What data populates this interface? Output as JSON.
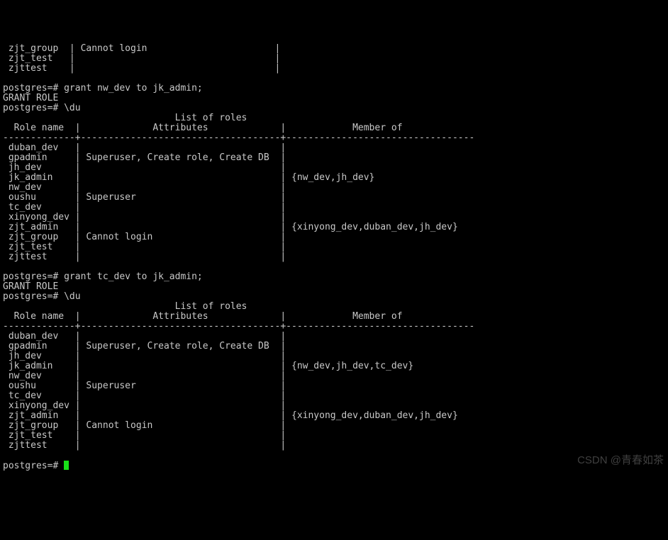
{
  "top": {
    "rows": [
      {
        "role": " zjt_group  ",
        "attrs": " Cannot login                       ",
        "member": ""
      },
      {
        "role": " zjt_test   ",
        "attrs": "                                    ",
        "member": ""
      },
      {
        "role": " zjttest    ",
        "attrs": "                                    ",
        "member": ""
      }
    ]
  },
  "block1": {
    "cmd1_prompt": "postgres=# ",
    "cmd1": "grant nw_dev to jk_admin;",
    "resp1": "GRANT ROLE",
    "cmd2_prompt": "postgres=# ",
    "cmd2": "\\du",
    "title_pad": "                               ",
    "title": "List of roles",
    "header": {
      "role": "  Role name  ",
      "attrs": "             Attributes             ",
      "member": "            Member of             "
    },
    "sep": "-------------+------------------------------------+----------------------------------",
    "rows": [
      {
        "role": " duban_dev   ",
        "attrs": "                                    ",
        "member": ""
      },
      {
        "role": " gpadmin     ",
        "attrs": " Superuser, Create role, Create DB  ",
        "member": ""
      },
      {
        "role": " jh_dev      ",
        "attrs": "                                    ",
        "member": ""
      },
      {
        "role": " jk_admin    ",
        "attrs": "                                    ",
        "member": " {nw_dev,jh_dev}"
      },
      {
        "role": " nw_dev      ",
        "attrs": "                                    ",
        "member": ""
      },
      {
        "role": " oushu       ",
        "attrs": " Superuser                          ",
        "member": ""
      },
      {
        "role": " tc_dev      ",
        "attrs": "                                    ",
        "member": ""
      },
      {
        "role": " xinyong_dev ",
        "attrs": "                                    ",
        "member": ""
      },
      {
        "role": " zjt_admin   ",
        "attrs": "                                    ",
        "member": " {xinyong_dev,duban_dev,jh_dev}"
      },
      {
        "role": " zjt_group   ",
        "attrs": " Cannot login                       ",
        "member": ""
      },
      {
        "role": " zjt_test    ",
        "attrs": "                                    ",
        "member": ""
      },
      {
        "role": " zjttest     ",
        "attrs": "                                    ",
        "member": ""
      }
    ]
  },
  "block2": {
    "cmd1_prompt": "postgres=# ",
    "cmd1": "grant tc_dev to jk_admin;",
    "resp1": "GRANT ROLE",
    "cmd2_prompt": "postgres=# ",
    "cmd2": "\\du",
    "title_pad": "                               ",
    "title": "List of roles",
    "header": {
      "role": "  Role name  ",
      "attrs": "             Attributes             ",
      "member": "            Member of             "
    },
    "sep": "-------------+------------------------------------+----------------------------------",
    "rows": [
      {
        "role": " duban_dev   ",
        "attrs": "                                    ",
        "member": ""
      },
      {
        "role": " gpadmin     ",
        "attrs": " Superuser, Create role, Create DB  ",
        "member": ""
      },
      {
        "role": " jh_dev      ",
        "attrs": "                                    ",
        "member": ""
      },
      {
        "role": " jk_admin    ",
        "attrs": "                                    ",
        "member": " {nw_dev,jh_dev,tc_dev}"
      },
      {
        "role": " nw_dev      ",
        "attrs": "                                    ",
        "member": ""
      },
      {
        "role": " oushu       ",
        "attrs": " Superuser                          ",
        "member": ""
      },
      {
        "role": " tc_dev      ",
        "attrs": "                                    ",
        "member": ""
      },
      {
        "role": " xinyong_dev ",
        "attrs": "                                    ",
        "member": ""
      },
      {
        "role": " zjt_admin   ",
        "attrs": "                                    ",
        "member": " {xinyong_dev,duban_dev,jh_dev}"
      },
      {
        "role": " zjt_group   ",
        "attrs": " Cannot login                       ",
        "member": ""
      },
      {
        "role": " zjt_test    ",
        "attrs": "                                    ",
        "member": ""
      },
      {
        "role": " zjttest     ",
        "attrs": "                                    ",
        "member": ""
      }
    ]
  },
  "final_prompt": "postgres=# ",
  "pipe": "|",
  "watermark": "CSDN @青春如茶"
}
